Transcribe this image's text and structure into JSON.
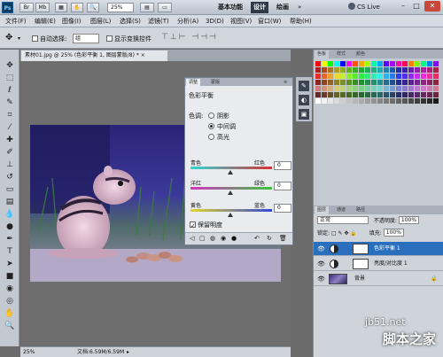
{
  "titlebar": {
    "logo": "Ps",
    "zoom": "25%",
    "workspace_basic": "基本功能",
    "workspace_design": "设计",
    "workspace_paint": "绘画",
    "workspace_more": "»",
    "cs_live": "CS Live",
    "minimize": "–",
    "restore": "□",
    "close": "✕"
  },
  "menu": [
    "文件(F)",
    "编辑(E)",
    "图像(I)",
    "图层(L)",
    "选择(S)",
    "滤镜(T)",
    "分析(A)",
    "3D(D)",
    "视图(V)",
    "窗口(W)",
    "帮助(H)"
  ],
  "options": {
    "auto_select": "自动选择:",
    "auto_select_value": "组",
    "show_transform": "显示变换控件"
  },
  "document": {
    "tab_title": "素材01.jpg @ 25% (色彩平衡 1, 图层蒙版/8) *",
    "zoom": "25%",
    "doc_size": "文档:6.59M/6.59M"
  },
  "color_balance": {
    "tab_adjust": "调整",
    "tab_mask": "蒙版",
    "title": "色彩平衡",
    "tone_label": "色调:",
    "tone_options": [
      "阴影",
      "中间调",
      "高光"
    ],
    "tone_selected": 1,
    "sliders": [
      {
        "left": "青色",
        "right": "红色",
        "value": "0"
      },
      {
        "left": "洋红",
        "right": "绿色",
        "value": "0"
      },
      {
        "left": "黄色",
        "right": "蓝色",
        "value": "0"
      }
    ],
    "preserve_luminosity": "保留明度"
  },
  "panels": {
    "swatch_tabs": [
      "色板",
      "样式",
      "颜色"
    ],
    "layer_tabs": [
      "图层",
      "通道",
      "路径"
    ],
    "blend_mode": "正常",
    "opacity_label": "不透明度:",
    "opacity": "100%",
    "lock_label": "锁定:",
    "fill_label": "填充:",
    "fill": "100%"
  },
  "layers": [
    {
      "name": "色彩平衡 1",
      "type": "color-balance",
      "active": true
    },
    {
      "name": "亮度/对比度 1",
      "type": "brightness-contrast",
      "active": false
    },
    {
      "name": "背景",
      "type": "image",
      "active": false
    }
  ],
  "watermark": {
    "site": "jb51.net",
    "brand": "脚本之家"
  }
}
